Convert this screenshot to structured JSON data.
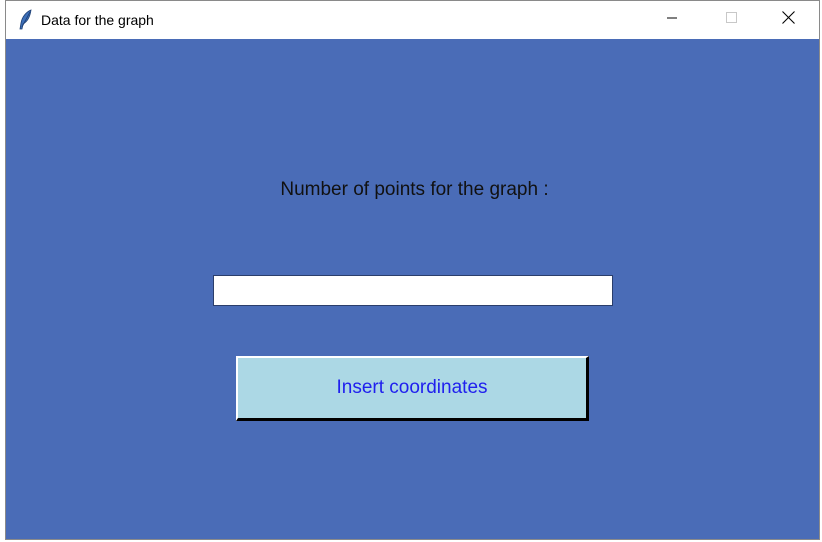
{
  "window": {
    "title": "Data for the graph",
    "app_icon": "feather-icon",
    "controls": {
      "minimize_icon": "minimize-icon",
      "maximize_icon": "maximize-icon",
      "close_icon": "close-icon"
    }
  },
  "form": {
    "prompt_label": "Number of points for the graph :",
    "points_input": {
      "value": "",
      "placeholder": ""
    },
    "insert_button_label": "Insert coordinates"
  },
  "colors": {
    "background": "#4a6cb7",
    "button_background": "#acd8e5",
    "button_text": "#2020ee"
  }
}
